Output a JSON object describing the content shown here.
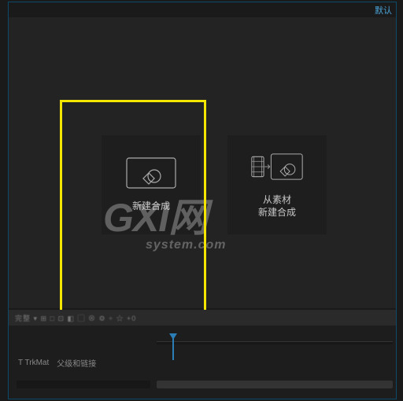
{
  "header": {
    "defaultLabel": "默认"
  },
  "composition": {
    "newLabel": "新建合成",
    "fromFootageLine1": "从素材",
    "fromFootageLine2": "新建合成"
  },
  "watermark": {
    "main": "GXI网",
    "sub": "system.com"
  },
  "timeline": {
    "toolbarBlur": "完整 ▾  ⊞ □ ⊡ ◧  ▢ ⊗  ⚙  ÷ ☆  +0",
    "trkmatLabel": "T  TrkMat",
    "parentLinkLabel": "父级和链接"
  },
  "colors": {
    "accent": "#2a7db5",
    "highlight": "#f4e600",
    "panelBg": "#232323"
  }
}
